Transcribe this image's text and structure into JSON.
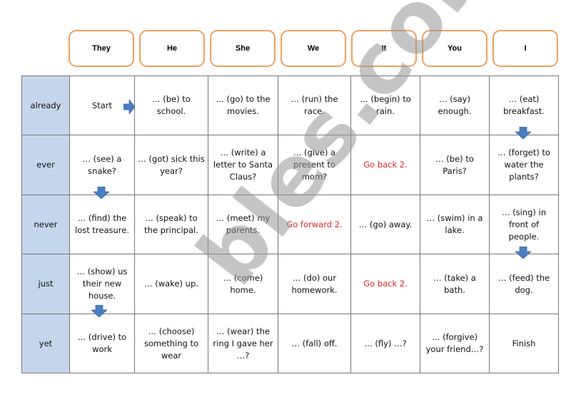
{
  "pronouns": [
    "They",
    "He",
    "She",
    "We",
    "It",
    "You",
    "I"
  ],
  "rows": [
    {
      "adverb": "already",
      "cells": [
        {
          "text": "Start",
          "style": "big"
        },
        {
          "text": "… (be) to school."
        },
        {
          "text": "… (go) to the movies."
        },
        {
          "text": "… (run) the race."
        },
        {
          "text": "… (begin) to rain."
        },
        {
          "text": "… (say) enough."
        },
        {
          "text": "… (eat) breakfast."
        }
      ]
    },
    {
      "adverb": "ever",
      "cells": [
        {
          "text": "… (see) a snake?"
        },
        {
          "text": "… (got) sick this year?"
        },
        {
          "text": "… (write) a letter to Santa Claus?"
        },
        {
          "text": "… (give) a present to mom?"
        },
        {
          "text": "Go back 2.",
          "style": "red"
        },
        {
          "text": "… (be) to Paris?"
        },
        {
          "text": "… (forget) to water the plants?"
        }
      ]
    },
    {
      "adverb": "never",
      "cells": [
        {
          "text": "… (find) the lost treasure."
        },
        {
          "text": "… (speak) to the principal."
        },
        {
          "text": "… (meet) my parents."
        },
        {
          "text": "Go forward 2.",
          "style": "red"
        },
        {
          "text": "… (go) away."
        },
        {
          "text": "… (swim) in a lake."
        },
        {
          "text": "… (sing) in front of people."
        }
      ]
    },
    {
      "adverb": "just",
      "cells": [
        {
          "text": "… (show) us their new house."
        },
        {
          "text": "… (wake) up."
        },
        {
          "text": "… (come) home."
        },
        {
          "text": "… (do) our homework."
        },
        {
          "text": "Go back 2.",
          "style": "red"
        },
        {
          "text": "… (take) a bath."
        },
        {
          "text": "… (feed) the dog."
        }
      ]
    },
    {
      "adverb": "yet",
      "cells": [
        {
          "text": "… (drive) to work"
        },
        {
          "text": "… (choose) something to wear"
        },
        {
          "text": "… (wear) the ring I gave her …?"
        },
        {
          "text": "… (fall) off."
        },
        {
          "text": "… (fly) …?"
        },
        {
          "text": "… (forgive) your friend…?"
        },
        {
          "text": "Finish",
          "style": "big"
        }
      ]
    }
  ],
  "arrows": [
    {
      "icon": "arrow-right-icon",
      "from": "Start",
      "to": "… (be) to school."
    },
    {
      "icon": "arrow-down-icon",
      "from": "… (eat) breakfast.",
      "to": "… (forget) to water the plants?"
    },
    {
      "icon": "arrow-down-icon",
      "from": "… (see) a snake?",
      "to": "… (find) the lost treasure."
    },
    {
      "icon": "arrow-down-icon",
      "from": "… (sing) in front of people.",
      "to": "… (feed) the dog."
    },
    {
      "icon": "arrow-down-icon",
      "from": "… (show) us their new house.",
      "to": "… (drive) to work"
    }
  ],
  "watermark": "bles.com",
  "colors": {
    "pronoun_border": "#f0a05a",
    "adverb_fill": "#c5d6ec",
    "special_text": "#e0262a",
    "arrow": "#4a7ec2"
  }
}
